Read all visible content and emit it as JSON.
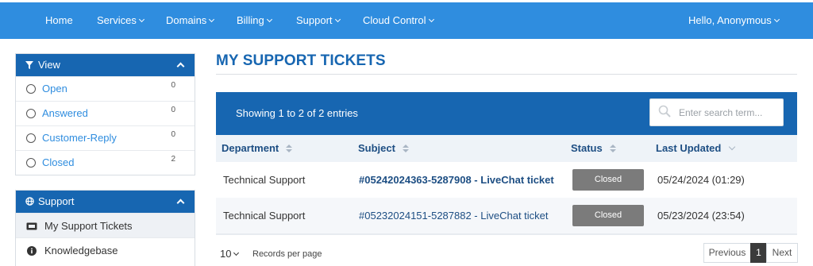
{
  "nav": {
    "items": [
      {
        "label": "Home",
        "dropdown": false
      },
      {
        "label": "Services",
        "dropdown": true
      },
      {
        "label": "Domains",
        "dropdown": true
      },
      {
        "label": "Billing",
        "dropdown": true
      },
      {
        "label": "Support",
        "dropdown": true
      },
      {
        "label": "Cloud Control",
        "dropdown": true
      }
    ],
    "user": "Hello, Anonymous"
  },
  "view_panel": {
    "title": "View",
    "icon": "filter-icon",
    "items": [
      {
        "label": "Open",
        "count": "0"
      },
      {
        "label": "Answered",
        "count": "0"
      },
      {
        "label": "Customer-Reply",
        "count": "0"
      },
      {
        "label": "Closed",
        "count": "2"
      }
    ]
  },
  "support_panel": {
    "title": "Support",
    "icon": "globe-icon",
    "items": [
      {
        "label": "My Support Tickets",
        "icon": "ticket-icon",
        "active": true
      },
      {
        "label": "Knowledgebase",
        "icon": "info-icon",
        "active": false
      }
    ]
  },
  "main": {
    "title": "MY SUPPORT TICKETS",
    "showing": "Showing 1 to 2 of 2 entries",
    "search_placeholder": "Enter search term...",
    "columns": [
      "Department",
      "Subject",
      "Status",
      "Last Updated"
    ],
    "rows": [
      {
        "department": "Technical Support",
        "subject": "#05242024363-5287908 - LiveChat ticket",
        "subject_bold": true,
        "status": "Closed",
        "updated": "05/24/2024 (01:29)"
      },
      {
        "department": "Technical Support",
        "subject": "#05232024151-5287882 - LiveChat ticket",
        "subject_bold": false,
        "status": "Closed",
        "updated": "05/23/2024 (23:54)"
      }
    ],
    "records_value": "10",
    "records_label": "Records per page",
    "pagination": {
      "previous": "Previous",
      "page": "1",
      "next": "Next"
    }
  },
  "colors": {
    "nav_bg": "#2f8ddf",
    "panel_head": "#1766b1",
    "title": "#1766b1",
    "link": "#2f8ddf",
    "status_closed": "#7b7b7b"
  }
}
